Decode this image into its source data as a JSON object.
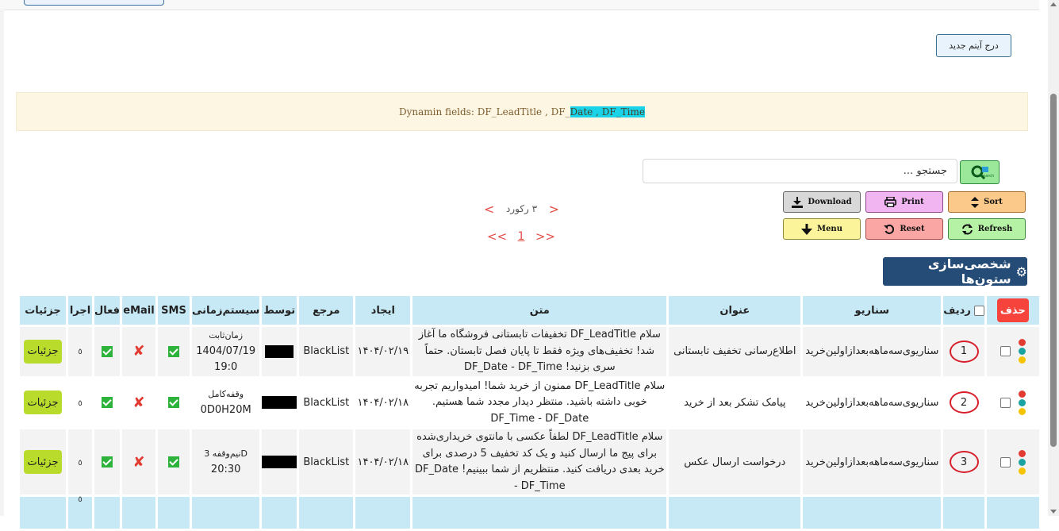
{
  "toolbar": {
    "new_item_label": "درج آیتم جدید"
  },
  "dynamic_fields": {
    "text_prefix": "Dynamin fields: DF_LeadTitle , DF_",
    "text_highlight": "Date , DF_Time",
    "highlight_color": "#1ad3e8"
  },
  "search": {
    "placeholder": "جستجو ...",
    "value": "",
    "button_caption": "Search"
  },
  "actions": {
    "download": "Download",
    "print": "Print",
    "sort": "Sort",
    "menu": "Menu",
    "reset": "Reset",
    "refresh": "Refresh"
  },
  "records": {
    "prev": "<",
    "next": ">",
    "count_text": "۳ رکورد"
  },
  "pager": {
    "first": "<<",
    "page": "1",
    "last": ">>"
  },
  "customize_label": "شخصی‌سازی ستون‌ها",
  "table": {
    "headers": {
      "details": "جزئیات",
      "run": "اجرا",
      "active": "فعال",
      "email": "eMail",
      "sms": "SMS",
      "schedule": "سیستم‌زمانی",
      "by": "توسط",
      "ref": "مرجع",
      "created": "ایجاد",
      "text": "متن",
      "title": "عنوان",
      "scenario": "سناریو",
      "row": "ردیف",
      "delete": "حذف"
    },
    "rows": [
      {
        "details": "جزئیات",
        "run": "٥",
        "time_label": "زمان‌ثابت",
        "time_value": "1404/07/19 19:0",
        "ref": "BlackList",
        "created": "۱۴۰۴/۰۲/۱۹",
        "text": "سلام DF_LeadTitle  تخفیفات تابستانی فروشگاه ما آغاز شد! تخفیف‌های ویژه فقط تا پایان فصل تابستان. حتماً سری بزنید! DF_Date - DF_Time",
        "title": "اطلاع‌رسانی تخفیف تابستانی",
        "scenario": "سناریوی‌سه‌ماهه‌بعدازاولین‌خرید",
        "row": "1"
      },
      {
        "details": "جزئیات",
        "run": "٥",
        "time_label": "وقفه‌کامل",
        "time_value": "0D0H20M",
        "ref": "BlackList",
        "created": "۱۴۰۴/۰۲/۱۸",
        "text": "سلام DF_LeadTitle ممنون از خرید شما! امیدواریم تجربه خوبی داشته باشید. منتظر دیدار مجدد شما هستیم. DF_Time - DF_Date",
        "title": "پیامک تشکر بعد از خرید",
        "scenario": "سناریوی‌سه‌ماهه‌بعدازاولین‌خرید",
        "row": "2"
      },
      {
        "details": "جزئیات",
        "run": "٥",
        "time_label": "نیم‌وقفه 3D",
        "time_value": "20:30",
        "ref": "BlackList",
        "created": "۱۴۰۴/۰۲/۱۸",
        "text": "سلام DF_LeadTitle لطفاً عکسی با مانتوی خریداری‌شده برای پیج ما ارسال کنید و یک کد تخفیف 5 درصدی برای خرید بعدی دریافت کنید. منتظریم از شما ببینیم! DF_Date - DF_Time",
        "title": "درخواست ارسال عکس",
        "scenario": "سناریوی‌سه‌ماهه‌بعدازاولین‌خرید",
        "row": "3"
      }
    ],
    "footer_run": "٥"
  },
  "status_dot_colors": [
    "#e23b32",
    "#1aa3a0",
    "#f5c300"
  ],
  "colors": {
    "header_bg": "#c7e9f6",
    "customize_bg": "#254b77",
    "details_btn": "#b9db2c",
    "delete_btn": "#f6433c"
  }
}
